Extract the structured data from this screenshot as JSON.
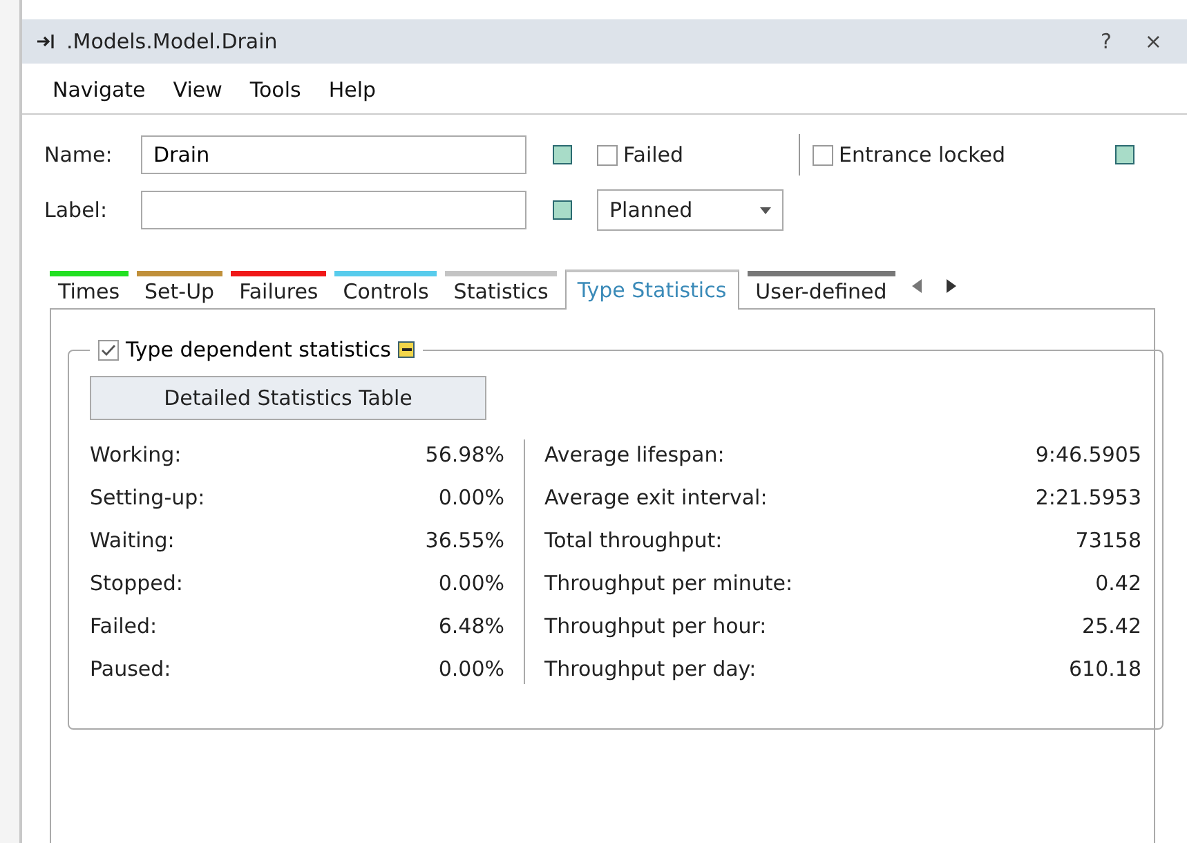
{
  "window": {
    "title": ".Models.Model.Drain",
    "help": "?",
    "close": "×"
  },
  "menu": [
    "Navigate",
    "View",
    "Tools",
    "Help"
  ],
  "form": {
    "name_label": "Name:",
    "name_value": "Drain",
    "label_label": "Label:",
    "failed": {
      "label": "Failed",
      "checked": false
    },
    "entrance_locked": {
      "label": "Entrance locked",
      "checked": false
    },
    "status": "Planned"
  },
  "tabs": [
    {
      "label": "Times",
      "color": "#22e022",
      "selected": false
    },
    {
      "label": "Set-Up",
      "color": "#c0903a",
      "selected": false
    },
    {
      "label": "Failures",
      "color": "#f01818",
      "selected": false
    },
    {
      "label": "Controls",
      "color": "#58ccec",
      "selected": false
    },
    {
      "label": "Statistics",
      "color": "#c4c4c4",
      "selected": false
    },
    {
      "label": "Type Statistics",
      "color": "#c4c4c4",
      "selected": true
    },
    {
      "label": "User-defined",
      "color": "#787878",
      "selected": false
    }
  ],
  "group": {
    "title": "Type dependent statistics",
    "checked": true,
    "button": "Detailed Statistics Table"
  },
  "left_stats": [
    {
      "label": "Working:",
      "value": "56.98%"
    },
    {
      "label": "Setting-up:",
      "value": "0.00%"
    },
    {
      "label": "Waiting:",
      "value": "36.55%"
    },
    {
      "label": "Stopped:",
      "value": "0.00%"
    },
    {
      "label": "Failed:",
      "value": "6.48%"
    },
    {
      "label": "Paused:",
      "value": "0.00%"
    }
  ],
  "right_stats": [
    {
      "label": "Average lifespan:",
      "value": "9:46.5905"
    },
    {
      "label": "Average exit interval:",
      "value": "2:21.5953"
    },
    {
      "label": "Total throughput:",
      "value": "73158"
    },
    {
      "label": "Throughput per minute:",
      "value": "0.42"
    },
    {
      "label": "Throughput per hour:",
      "value": "25.42"
    },
    {
      "label": "Throughput per day:",
      "value": "610.18"
    }
  ]
}
